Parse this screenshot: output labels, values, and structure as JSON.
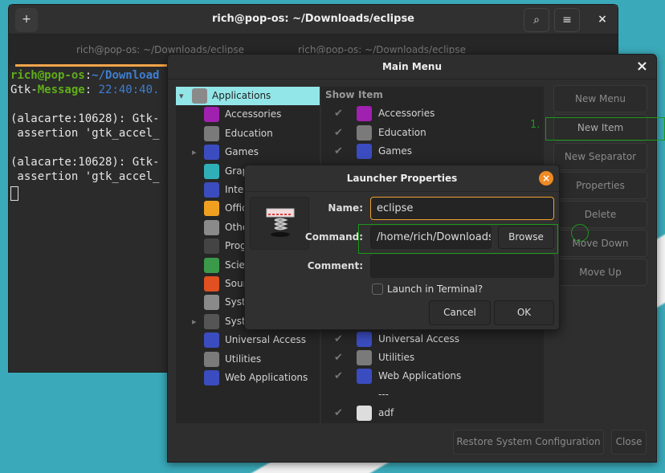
{
  "terminal": {
    "title": "rich@pop-os: ~/Downloads/eclipse",
    "tabs": [
      {
        "label": "rich@pop-os: ~/Downloads/eclipse"
      },
      {
        "label": "rich@pop-os: ~/Downloads/eclipse"
      }
    ],
    "lines": {
      "prompt_user": "rich@pop-os",
      "prompt_sep": ":",
      "prompt_path": "~/Download",
      "l2a": "Gtk-",
      "l2b": "Message",
      "l2c": ": ",
      "l2d": "22:40:40.",
      "l4": "(alacarte:10628): Gtk-",
      "l5": " assertion 'gtk_accel_",
      "l7": "(alacarte:10628): Gtk-",
      "l8": " assertion 'gtk_accel_"
    },
    "search_icon": "⌕",
    "menu_icon": "≡",
    "close_icon": "×",
    "new_tab_icon": "+"
  },
  "main_menu": {
    "title": "Main Menu",
    "close": "×",
    "tree": [
      {
        "label": "Applications",
        "color": "#8a8a8a",
        "glyph": "⚙",
        "expander": "▾"
      },
      {
        "label": "Accessories",
        "color": "#a020b0",
        "glyph": "✂"
      },
      {
        "label": "Education",
        "color": "#7a7a7a",
        "glyph": "✎"
      },
      {
        "label": "Games",
        "color": "#3b4cc0",
        "glyph": "✚",
        "expander": "▸"
      },
      {
        "label": "Grap",
        "color": "#2fb0b8",
        "glyph": "✎"
      },
      {
        "label": "Inter",
        "color": "#3b4cc0",
        "glyph": "◍"
      },
      {
        "label": "Offic",
        "color": "#f0a020",
        "glyph": "≡"
      },
      {
        "label": "Othe",
        "color": "#8a8a8a",
        "glyph": "⚙"
      },
      {
        "label": "Prog",
        "color": "#444",
        "glyph": "◣"
      },
      {
        "label": "Scie",
        "color": "#3a9a4a",
        "glyph": "⚗"
      },
      {
        "label": "Sour",
        "color": "#e05020",
        "glyph": "♫"
      },
      {
        "label": "Syste",
        "color": "#8a8a8a",
        "glyph": "⚙"
      },
      {
        "label": "Syste",
        "color": "#555",
        "glyph": "▣",
        "expander": "▸"
      },
      {
        "label": "Universal Access",
        "color": "#3b4cc0",
        "glyph": "☺"
      },
      {
        "label": "Utilities",
        "color": "#7a7a7a",
        "glyph": "✎"
      },
      {
        "label": "Web Applications",
        "color": "#3b4cc0",
        "glyph": "◍"
      }
    ],
    "list_headers": {
      "show": "Show",
      "item": "Item"
    },
    "list_top": [
      {
        "label": "Accessories",
        "color": "#a020b0",
        "glyph": "✂",
        "show": true
      },
      {
        "label": "Education",
        "color": "#7a7a7a",
        "glyph": "✎",
        "show": true
      },
      {
        "label": "Games",
        "color": "#3b4cc0",
        "glyph": "✚",
        "show": true
      }
    ],
    "list_bottom": [
      {
        "label": "Universal Access",
        "color": "#3b4cc0",
        "glyph": "☺",
        "show": true
      },
      {
        "label": "Utilities",
        "color": "#7a7a7a",
        "glyph": "✎",
        "show": true
      },
      {
        "label": "Web Applications",
        "color": "#3b4cc0",
        "glyph": "◍",
        "show": true
      },
      {
        "label": "---"
      },
      {
        "label": "adf",
        "color": "#ddd",
        "glyph": "⌇",
        "show": true
      }
    ],
    "buttons": [
      "New Menu",
      "New Item",
      "New Separator",
      "Properties",
      "Delete",
      "Move Down",
      "Move Up"
    ],
    "restore": "Restore System Configuration",
    "close_button": "Close"
  },
  "dialog": {
    "title": "Launcher Properties",
    "close": "×",
    "name_label": "Name:",
    "name_value": "eclipse",
    "command_label": "Command:",
    "command_value": "/home/rich/Downloads/",
    "browse": "Browse",
    "comment_label": "Comment:",
    "comment_value": "",
    "launch_terminal": "Launch in Terminal?",
    "launch_terminal_checked": false,
    "cancel": "Cancel",
    "ok": "OK"
  },
  "annotation": {
    "step": "1."
  }
}
